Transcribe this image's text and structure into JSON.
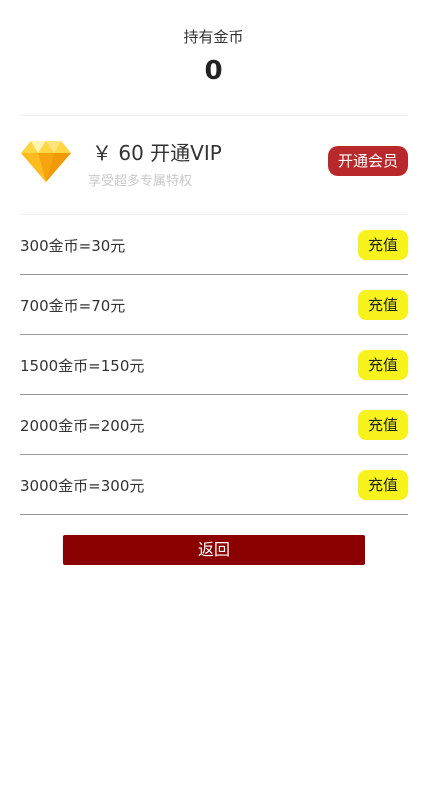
{
  "header": {
    "label": "持有金币",
    "coins": "0"
  },
  "vip": {
    "icon": "diamond-icon",
    "title": "￥ 60 开通VIP",
    "subtitle": "享受超多专属特权",
    "button_label": "开通会员",
    "button_color": "#b7292b"
  },
  "recharge": {
    "button_color": "#f7f21c",
    "items": [
      {
        "label": "300金币=30元",
        "button": "充值"
      },
      {
        "label": "700金币=70元",
        "button": "充值"
      },
      {
        "label": "1500金币=150元",
        "button": "充值"
      },
      {
        "label": "2000金币=200元",
        "button": "充值"
      },
      {
        "label": "3000金币=300元",
        "button": "充值"
      }
    ]
  },
  "footer": {
    "back_label": "返回",
    "back_color": "#8b0000"
  }
}
